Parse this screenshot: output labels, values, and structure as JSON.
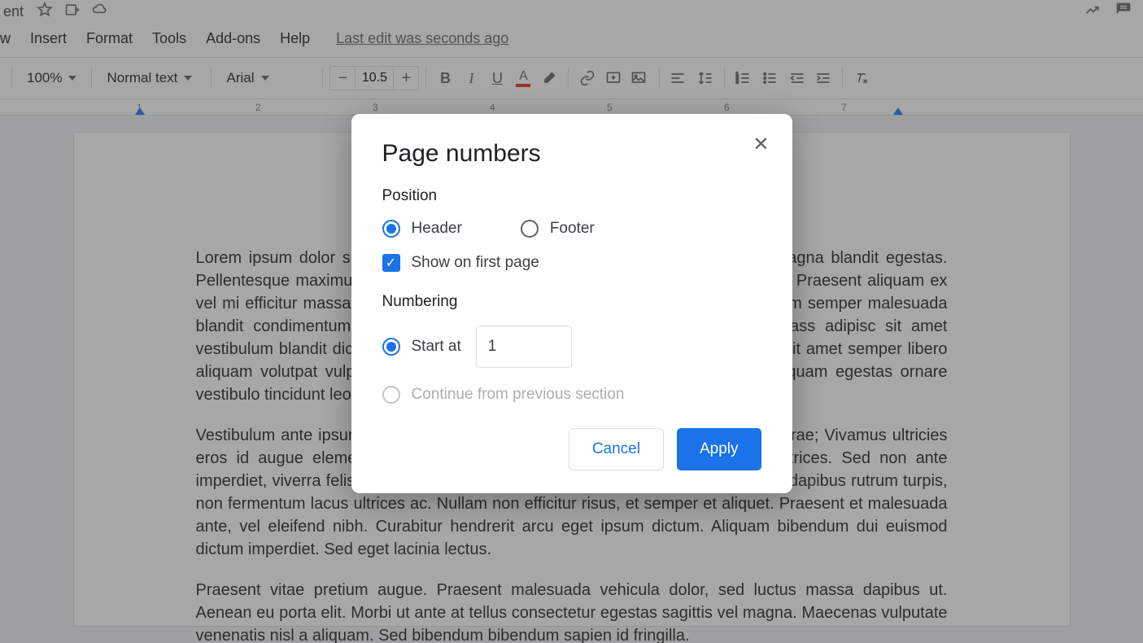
{
  "header": {
    "doc_title_fragment": "ent"
  },
  "menu": {
    "view": "w",
    "insert": "Insert",
    "format": "Format",
    "tools": "Tools",
    "addons": "Add-ons",
    "help": "Help",
    "last_edit": "Last edit was seconds ago"
  },
  "toolbar": {
    "zoom": "100%",
    "style": "Normal text",
    "font": "Arial",
    "font_size": "10.5",
    "minus": "−",
    "plus": "+"
  },
  "ruler": {
    "ticks": [
      "1",
      "2",
      "3",
      "4",
      "5",
      "6",
      "7"
    ]
  },
  "document": {
    "p1": "Lorem ipsum dolor sit amet, consectetur adipiscing elit. Vivamus et euismod magna blandit egestas. Pellentesque maximus metus non orci hendrerit vitae dictum vel iaculis convallis. Praesent aliquam ex vel mi efficitur massa scelerisque ac. Cras consectetur mollis euismod ex. Aliquam semper malesuada blandit condimentum eget. Cras est sodales nisl. Vivamus quis venenatis mass adipisc sit amet vestibulum blandit dictumst. Vestibulum efficitur aliquet neque nec pellentesque, sit amet semper libero aliquam volutpat vulputate vel. Sed eget vehicula sem, id dapibus congue. Aliquam egestas ornare vestibulo tincidunt leo.",
    "p2": "Vestibulum ante ipsum primis in faucibus orci luctus et ultrices posuere cubilia curae; Vivamus ultricies eros id augue elementum, vel aliquet tellus consequat. Nullam nec ipsum ultrices. Sed non ante imperdiet, viverra felis nec, sodales felis. Mauris lacinia lobortis ipsum vestibulum dapibus rutrum turpis, non fermentum lacus ultrices ac. Nullam non efficitur risus, et semper et aliquet. Praesent et malesuada ante, vel eleifend nibh. Curabitur hendrerit arcu eget ipsum dictum. Aliquam bibendum dui euismod dictum imperdiet. Sed eget lacinia lectus.",
    "p3": "Praesent vitae pretium augue. Praesent malesuada vehicula dolor, sed luctus massa dapibus ut. Aenean eu porta elit. Morbi ut ante at tellus consectetur egestas sagittis vel magna. Maecenas vulputate venenatis nisl a aliquam. Sed bibendum bibendum sapien id fringilla."
  },
  "dialog": {
    "title": "Page numbers",
    "position_label": "Position",
    "header_opt": "Header",
    "footer_opt": "Footer",
    "show_first": "Show on first page",
    "numbering_label": "Numbering",
    "start_at": "Start at",
    "start_value": "1",
    "continue_opt": "Continue from previous section",
    "cancel": "Cancel",
    "apply": "Apply"
  }
}
